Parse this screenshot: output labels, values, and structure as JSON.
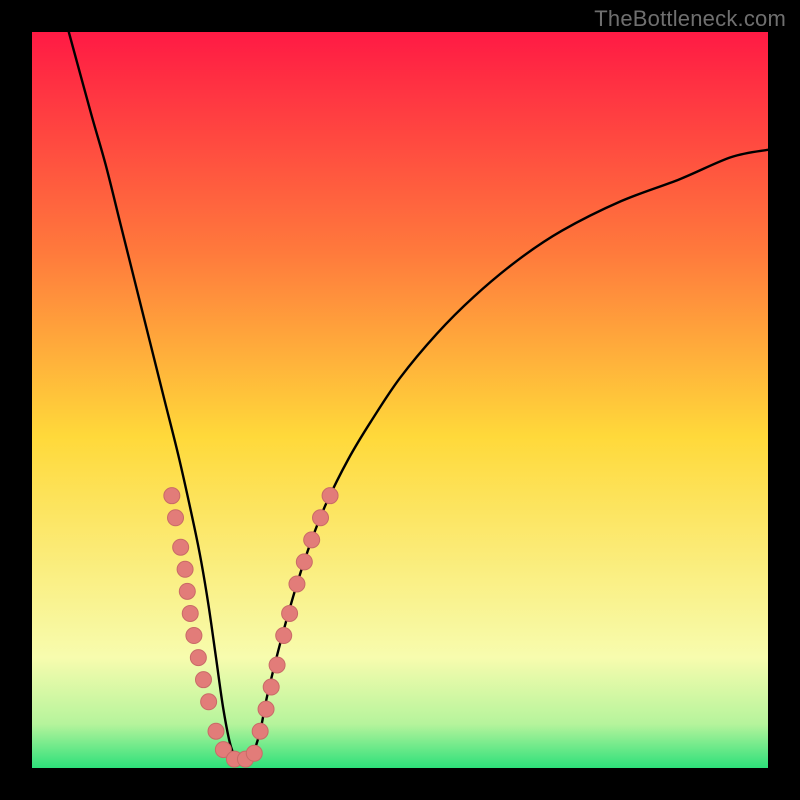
{
  "watermark": "TheBottleneck.com",
  "colors": {
    "frame": "#000000",
    "gradient_top": "#ff1a44",
    "gradient_mid_upper": "#ff7a3c",
    "gradient_mid": "#ffd93a",
    "gradient_lower": "#f7fcae",
    "gradient_band": "#b6f49c",
    "gradient_bottom": "#2de07a",
    "curve": "#000000",
    "marker_fill": "#e27c79",
    "marker_stroke": "#c96a67"
  },
  "chart_data": {
    "type": "line",
    "title": "",
    "xlabel": "",
    "ylabel": "",
    "xlim": [
      0,
      100
    ],
    "ylim": [
      0,
      100
    ],
    "curve": {
      "name": "bottleneck-curve",
      "x": [
        5,
        8,
        10,
        12,
        14,
        16,
        18,
        20,
        22,
        23,
        24,
        25,
        26,
        27,
        28,
        29,
        30,
        31,
        32,
        34,
        36,
        38,
        40,
        43,
        46,
        50,
        55,
        60,
        66,
        72,
        80,
        88,
        95,
        100
      ],
      "y": [
        100,
        89,
        82,
        74,
        66,
        58,
        50,
        42,
        33,
        28,
        22,
        15,
        8,
        3,
        1,
        1,
        2,
        5,
        10,
        18,
        25,
        31,
        36,
        42,
        47,
        53,
        59,
        64,
        69,
        73,
        77,
        80,
        83,
        84
      ]
    },
    "optimal_band": {
      "y_from": 0,
      "y_to": 6
    },
    "markers_left": {
      "name": "left-branch-points",
      "points": [
        {
          "x": 19.0,
          "y": 37
        },
        {
          "x": 19.5,
          "y": 34
        },
        {
          "x": 20.2,
          "y": 30
        },
        {
          "x": 20.8,
          "y": 27
        },
        {
          "x": 21.1,
          "y": 24
        },
        {
          "x": 21.5,
          "y": 21
        },
        {
          "x": 22.0,
          "y": 18
        },
        {
          "x": 22.6,
          "y": 15
        },
        {
          "x": 23.3,
          "y": 12
        },
        {
          "x": 24.0,
          "y": 9
        },
        {
          "x": 25.0,
          "y": 5
        },
        {
          "x": 26.0,
          "y": 2.5
        },
        {
          "x": 27.5,
          "y": 1.2
        },
        {
          "x": 29.0,
          "y": 1.2
        },
        {
          "x": 30.2,
          "y": 2.0
        }
      ]
    },
    "markers_right": {
      "name": "right-branch-points",
      "points": [
        {
          "x": 31.0,
          "y": 5
        },
        {
          "x": 31.8,
          "y": 8
        },
        {
          "x": 32.5,
          "y": 11
        },
        {
          "x": 33.3,
          "y": 14
        },
        {
          "x": 34.2,
          "y": 18
        },
        {
          "x": 35.0,
          "y": 21
        },
        {
          "x": 36.0,
          "y": 25
        },
        {
          "x": 37.0,
          "y": 28
        },
        {
          "x": 38.0,
          "y": 31
        },
        {
          "x": 39.2,
          "y": 34
        },
        {
          "x": 40.5,
          "y": 37
        }
      ]
    }
  }
}
